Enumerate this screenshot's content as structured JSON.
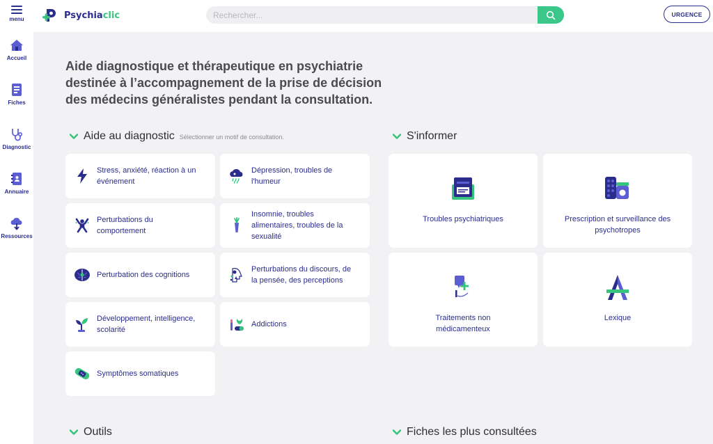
{
  "header": {
    "menu_label": "menu",
    "logo_text_part1": "Psychia",
    "logo_text_part2": "clic",
    "search_placeholder": "Rechercher...",
    "urgence_label": "URGENCE"
  },
  "sidebar": {
    "items": [
      {
        "label": "Accueil",
        "icon": "home-icon"
      },
      {
        "label": "Fiches",
        "icon": "fiches-icon"
      },
      {
        "label": "Diagnostic",
        "icon": "stethoscope-icon"
      },
      {
        "label": "Annuaire",
        "icon": "directory-icon"
      },
      {
        "label": "Ressources",
        "icon": "cloud-download-icon"
      }
    ]
  },
  "hero": {
    "line1": "Aide diagnostique et thérapeutique en psychiatrie",
    "line2": "destinée à l’accompagnement de la prise de décision",
    "line3": "des médecins généralistes pendant la consultation."
  },
  "diagnostic": {
    "title": "Aide au diagnostic",
    "subtitle": "Sélectionner un motif de consultation.",
    "items": [
      {
        "line1": "Stress, anxiété, réaction à un",
        "line2": "événement",
        "line3": "",
        "icon": "lightning-icon"
      },
      {
        "line1": "Dépression, troubles de",
        "line2": "l'humeur",
        "line3": "",
        "icon": "rain-cloud-icon"
      },
      {
        "line1": "Perturbations du",
        "line2": "comportement",
        "line3": "",
        "icon": "agitated-person-icon"
      },
      {
        "line1": "Insomnie, troubles",
        "line2": "alimentaires, troubles de la",
        "line3": "sexualité",
        "icon": "carrot-icon"
      },
      {
        "line1": "Perturbation des cognitions",
        "line2": "",
        "line3": "",
        "icon": "brain-icon"
      },
      {
        "line1": "Perturbations du discours, de",
        "line2": "la pensée, des perceptions",
        "line3": "",
        "icon": "eye-face-icon"
      },
      {
        "line1": "Développement, intelligence,",
        "line2": "scolarité",
        "line3": "",
        "icon": "sprout-icon"
      },
      {
        "line1": "Addictions",
        "line2": "",
        "line3": "",
        "icon": "addiction-icon"
      },
      {
        "line1": "Symptômes somatiques",
        "line2": "",
        "line3": "",
        "icon": "bandage-icon"
      }
    ]
  },
  "informer": {
    "title": "S'informer",
    "items": [
      {
        "line1": "Troubles psychiatriques",
        "line2": "",
        "icon": "folder-icon"
      },
      {
        "line1": "Prescription et surveillance des",
        "line2": "psychotropes",
        "icon": "pills-icon"
      },
      {
        "line1": "Traitements non",
        "line2": "médicamenteux",
        "icon": "care-hand-icon"
      },
      {
        "line1": "Lexique",
        "line2": "",
        "icon": "letter-a-icon"
      }
    ]
  },
  "outils": {
    "title": "Outils"
  },
  "fiches_consultees": {
    "title": "Fiches les plus consultées"
  },
  "colors": {
    "navy": "#2b2d8c",
    "green": "#38c47e",
    "background": "#f2f2f4"
  }
}
